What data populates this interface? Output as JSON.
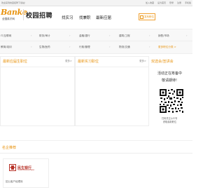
{
  "topbar": {
    "welcome": "欢迎来到校园招聘下载站！",
    "links": [
      "加入收藏",
      "设为首页",
      "登录",
      "注册",
      "手机版"
    ]
  },
  "header": {
    "logo_text": "Banke",
    "logo_sub": "全国英才网",
    "slogan": "校园招聘",
    "nav": [
      "找实习",
      "找兼职",
      "最新应届"
    ],
    "post_button": "发布职位"
  },
  "categories": {
    "row1": [
      "IT/互联网",
      "财务/审计",
      "金融/银行",
      "建筑/工程",
      "销售/市场"
    ],
    "row2": [
      "教育/培训",
      "生物/医药",
      "行政/管理",
      "物流/交通",
      "翻译/语言"
    ],
    "more_label": "更多职位分类 >"
  },
  "panels": [
    {
      "title": "最新应届生职位",
      "more": "更多>"
    },
    {
      "title": "最新实习职位",
      "more": "更多>"
    }
  ],
  "sidebar": {
    "title": "双选会/宣讲会",
    "lines": [
      "活动正在筹备中",
      "敬请期待!"
    ],
    "qr_caption": [
      "扫码关注公众号",
      "获取最新职位"
    ]
  },
  "recommend": {
    "title": "名企推荐",
    "bank_name": "民生银行",
    "bank_en": "CHINA MINSHENG BANK",
    "caption": "招公客户经理岗"
  },
  "colors": {
    "accent": "#e8930f",
    "bank_red": "#b8342a"
  }
}
